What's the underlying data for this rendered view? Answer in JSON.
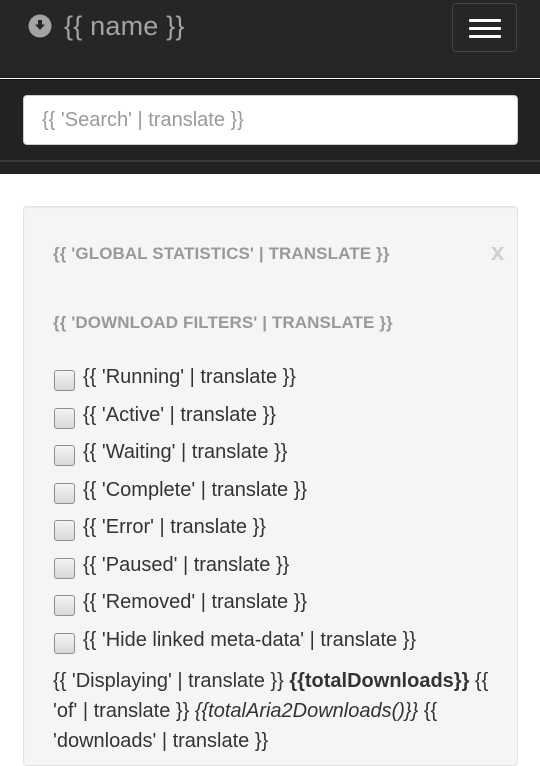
{
  "navbar": {
    "brand_icon": "circle-arrow-down-icon",
    "brand_text": "{{ name }}",
    "menu_icon": "hamburger-menu-icon"
  },
  "search": {
    "placeholder": "{{ 'Search' | translate }}",
    "value": ""
  },
  "panel": {
    "global_stats_title": "{{ 'GLOBAL STATISTICS' | TRANSLATE }}",
    "close_label": "x",
    "filters_title": "{{ 'DOWNLOAD FILTERS' | TRANSLATE }}",
    "filters": [
      {
        "label": "{{ 'Running' | translate }}",
        "checked": false
      },
      {
        "label": "{{ 'Active' | translate }}",
        "checked": false
      },
      {
        "label": "{{ 'Waiting' | translate }}",
        "checked": false
      },
      {
        "label": "{{ 'Complete' | translate }}",
        "checked": false
      },
      {
        "label": "{{ 'Error' | translate }}",
        "checked": false
      },
      {
        "label": "{{ 'Paused' | translate }}",
        "checked": false
      },
      {
        "label": "{{ 'Removed' | translate }}",
        "checked": false
      },
      {
        "label": "{{ 'Hide linked meta-data' | translate }}",
        "checked": false
      }
    ],
    "summary": {
      "displaying": "{{ 'Displaying' | translate }}",
      "total_downloads": "{{totalDownloads}}",
      "of": "{{ 'of' | translate }}",
      "total_aria2": "{{totalAria2Downloads()}}",
      "downloads": "{{ 'downloads' | translate }}"
    }
  },
  "colors": {
    "navbar_bg": "#262626",
    "search_strip_bg": "#222222",
    "panel_bg": "#f5f5f5",
    "muted_heading": "#999999",
    "text": "#333333"
  }
}
